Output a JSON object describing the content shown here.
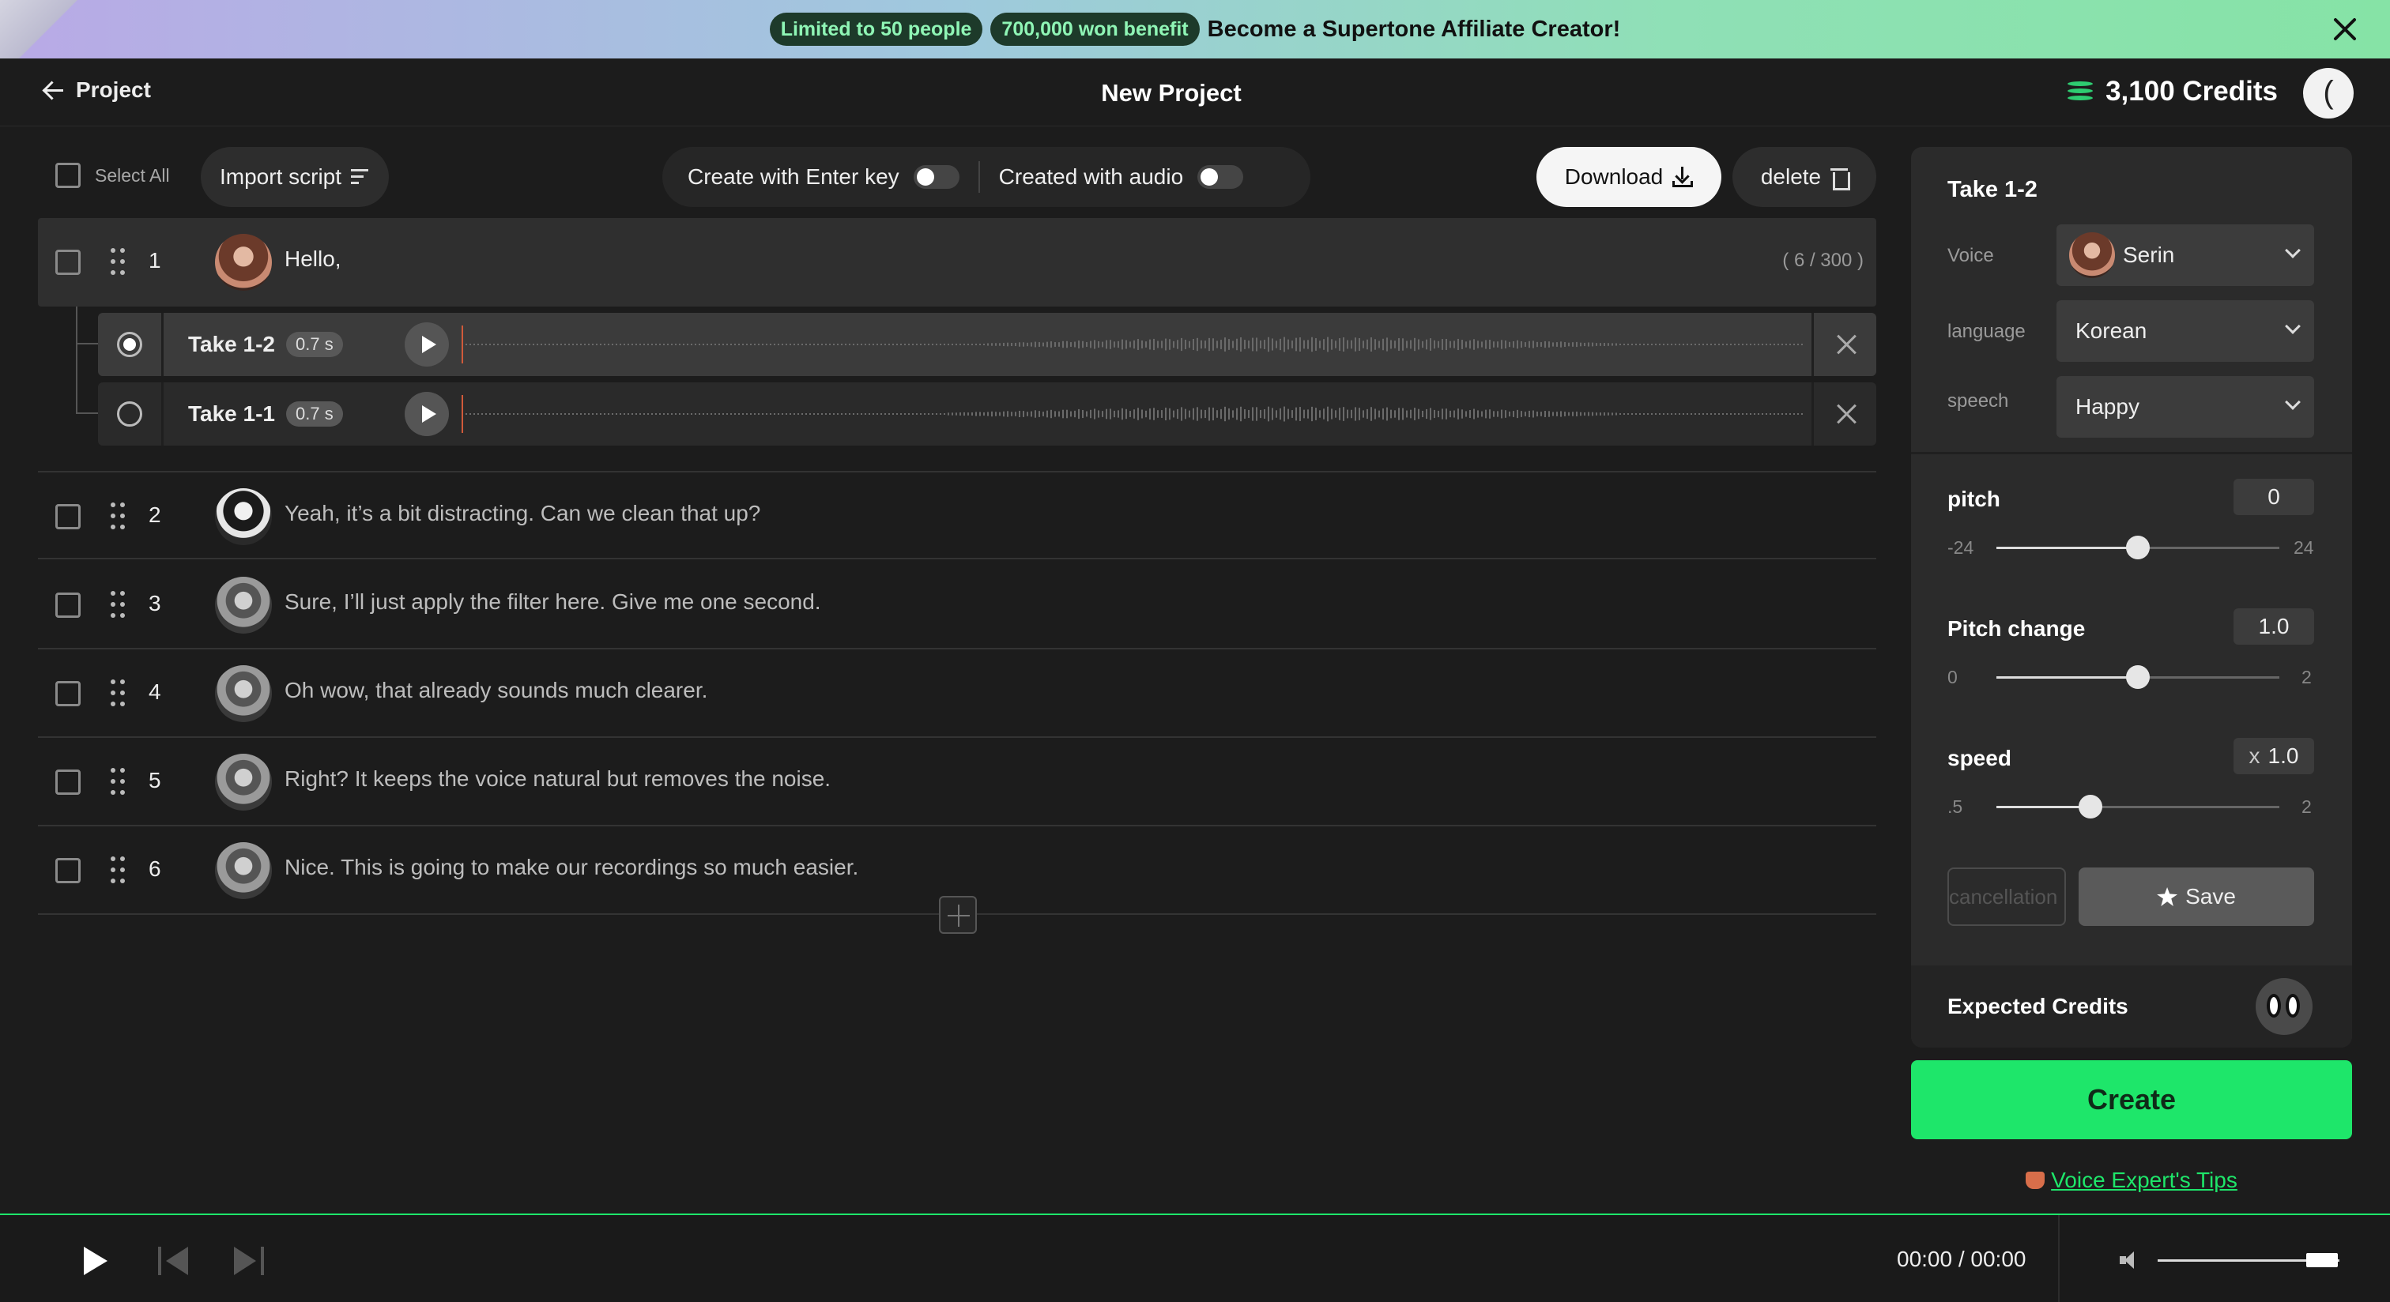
{
  "banner": {
    "pill1": "Limited to 50 people",
    "pill2": "700,000 won benefit",
    "text": "Become a Supertone Affiliate Creator!"
  },
  "header": {
    "back_label": "Project",
    "title": "New Project",
    "credits": "3,100 Credits",
    "avatar_initial": "("
  },
  "toolbar": {
    "select_all": "Select All",
    "import_script": "Import script",
    "create_enter": "Create with Enter key",
    "created_audio": "Created with audio",
    "download": "Download",
    "delete": "delete"
  },
  "lines": [
    {
      "num": "1",
      "text": "Hello,",
      "count": "( 6 / 300 )"
    },
    {
      "num": "2",
      "text": "Yeah, it’s a bit distracting. Can we clean that up?"
    },
    {
      "num": "3",
      "text": "Sure, I’ll just apply the filter here. Give me one second."
    },
    {
      "num": "4",
      "text": "Oh wow, that already sounds much clearer."
    },
    {
      "num": "5",
      "text": "Right? It keeps the voice natural but removes the noise."
    },
    {
      "num": "6",
      "text": "Nice. This is going to make our recordings so much easier."
    }
  ],
  "takes": [
    {
      "name": "Take 1-2",
      "duration": "0.7 s",
      "selected": true
    },
    {
      "name": "Take 1-1",
      "duration": "0.7 s",
      "selected": false
    }
  ],
  "panel": {
    "title": "Take 1-2",
    "voice_label": "Voice",
    "voice_value": "Serin",
    "language_label": "language",
    "language_value": "Korean",
    "speech_label": "speech",
    "speech_value": "Happy",
    "pitch": {
      "label": "pitch",
      "value": "0",
      "min": "-24",
      "max": "24",
      "fraction": 0.5
    },
    "pitch_change": {
      "label": "Pitch change",
      "value": "1.0",
      "min": "0",
      "max": "2",
      "fraction": 0.5
    },
    "speed": {
      "label": "speed",
      "prefix": "x",
      "value": "1.0",
      "min": ".5",
      "max": "2",
      "fraction": 0.333
    },
    "cancel": "cancellation",
    "save": "Save",
    "expected_credits": "Expected Credits"
  },
  "create": "Create",
  "tips": "Voice Expert's Tips",
  "player": {
    "time": "00:00 / 00:00",
    "volume": 0.9
  },
  "colors": {
    "accent": "#1ee66a",
    "background": "#1c1c1c",
    "panel": "#2b2b2b"
  }
}
